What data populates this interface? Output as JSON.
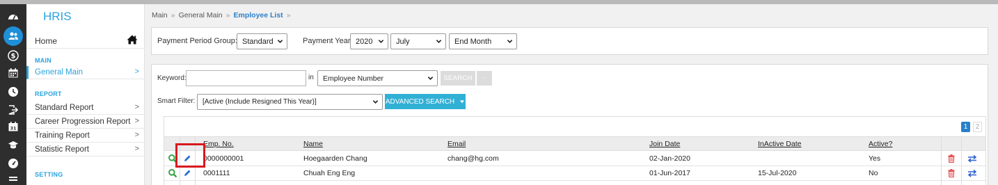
{
  "app": {
    "title": "HRIS",
    "colors": {
      "accent": "#2aa3df",
      "rail_bg": "#2e2e2e",
      "rail_active": "#1e8fd8",
      "button_blue": "#31b0d5",
      "delete_red": "#e34f4f",
      "highlight_box": "#d7191f"
    }
  },
  "rail": {
    "icons": [
      "dashboard-icon",
      "people-icon",
      "dollar-icon",
      "calendar-icon",
      "clock-icon",
      "logout-icon",
      "calendar-check-icon",
      "graduation-icon",
      "speedometer-icon"
    ],
    "active_index": 1
  },
  "sidebar": {
    "home": {
      "label": "Home",
      "icon": "home-icon"
    },
    "sections": [
      {
        "title": "MAIN",
        "items": [
          {
            "label": "General Main",
            "chevron": ">",
            "active": true
          }
        ]
      },
      {
        "title": "REPORT",
        "items": [
          {
            "label": "Standard Report",
            "chevron": ">"
          },
          {
            "label": "Career Progression Report",
            "chevron": ">"
          },
          {
            "label": "Training Report",
            "chevron": ">"
          },
          {
            "label": "Statistic Report",
            "chevron": ">"
          }
        ]
      },
      {
        "title": "SETTING",
        "items": []
      }
    ]
  },
  "breadcrumb": {
    "items": [
      "Main",
      "General Main",
      "Employee List"
    ],
    "separator": "»"
  },
  "period": {
    "group_label": "Payment Period Group:",
    "group_value": "Standard",
    "year_label": "Payment Year:",
    "year_value": "2020",
    "month_value": "July",
    "end_value": "End Month"
  },
  "search": {
    "keyword_label": "Keyword:",
    "keyword_value": "",
    "in_label": "in",
    "field_value": "Employee Number",
    "search_button": "SEARCH",
    "minus_button": "-",
    "smart_filter_label": "Smart Filter:",
    "smart_filter_value": "[Active (Include Resigned This Year)]",
    "advanced_button": "ADVANCED SEARCH"
  },
  "pager": {
    "pages": [
      "1",
      "2"
    ],
    "current": "1"
  },
  "table": {
    "columns": [
      "Emp. No.",
      "Name",
      "Email",
      "Join Date",
      "InActive Date",
      "Active?"
    ],
    "rows": [
      {
        "emp_no": "0000000001",
        "name": "Hoegaarden Chang",
        "email": "chang@hg.com",
        "join_date": "02-Jan-2020",
        "inactive_date": "",
        "active": "Yes"
      },
      {
        "emp_no": "0001111",
        "name": "Chuah Eng Eng",
        "email": "",
        "join_date": "01-Jun-2017",
        "inactive_date": "15-Jul-2020",
        "active": "No"
      }
    ],
    "row_icons": [
      "view-icon",
      "edit-icon",
      "delete-icon",
      "transfer-icon"
    ]
  }
}
